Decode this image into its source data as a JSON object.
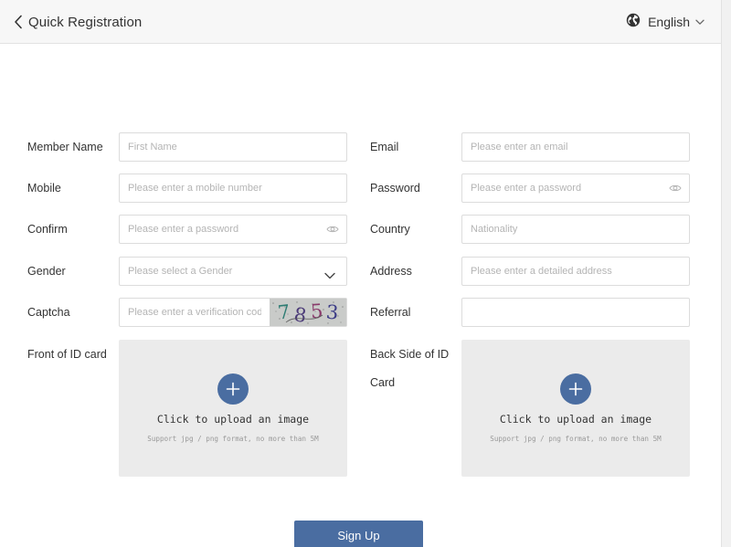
{
  "header": {
    "title": "Quick Registration",
    "language": "English"
  },
  "form": {
    "member_name": {
      "label": "Member Name",
      "placeholder": "First Name"
    },
    "email": {
      "label": "Email",
      "placeholder": "Please enter an email"
    },
    "mobile": {
      "label": "Mobile",
      "placeholder": "Please enter a mobile number"
    },
    "password": {
      "label": "Password",
      "placeholder": "Please enter a password"
    },
    "confirm": {
      "label": "Confirm",
      "placeholder": "Please enter a password"
    },
    "country": {
      "label": "Country",
      "placeholder": "Nationality"
    },
    "gender": {
      "label": "Gender",
      "placeholder": "Please select a Gender"
    },
    "address": {
      "label": "Address",
      "placeholder": "Please enter a detailed address"
    },
    "captcha": {
      "label": "Captcha",
      "placeholder": "Please enter a verification code",
      "code": "7853"
    },
    "referral": {
      "label": "Referral",
      "placeholder": ""
    },
    "front_id": {
      "label": "Front of ID card",
      "upload_title": "Click to upload an image",
      "upload_hint": "Support jpg / png format, no more than 5M"
    },
    "back_id": {
      "label_line1": "Back Side of ID",
      "label_line2": "Card",
      "upload_title": "Click to upload an image",
      "upload_hint": "Support jpg / png format, no more than 5M"
    }
  },
  "actions": {
    "signup_label": "Sign Up"
  },
  "colors": {
    "accent": "#4a6da1",
    "upload_bg": "#ebebeb",
    "header_bg": "#f7f7f7",
    "border": "#dcdcdc"
  }
}
